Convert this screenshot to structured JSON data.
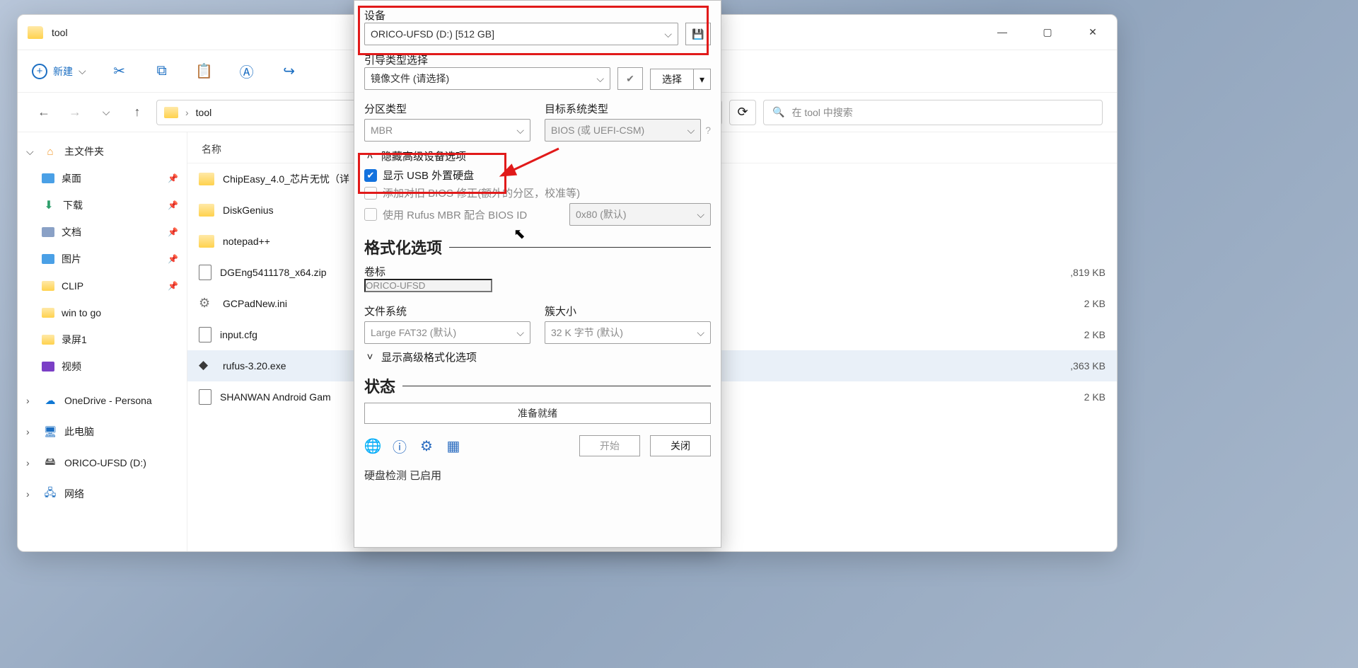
{
  "explorer": {
    "title": "tool",
    "toolbar": {
      "new_label": "新建"
    },
    "address": {
      "label": "tool"
    },
    "search": {
      "placeholder": "在 tool 中搜索"
    },
    "sidebar": {
      "home": "主文件夹",
      "desktop": "桌面",
      "downloads": "下载",
      "documents": "文档",
      "pictures": "图片",
      "clip": "CLIP",
      "wintogo": "win to go",
      "luping": "录屏1",
      "video": "视频",
      "onedrive": "OneDrive - Persona",
      "thispc": "此电脑",
      "orico": "ORICO-UFSD (D:)",
      "network": "网络"
    },
    "columns": {
      "name": "名称"
    },
    "files": [
      {
        "name": "ChipEasy_4.0_芯片无忧（详",
        "type": "folder",
        "size": ""
      },
      {
        "name": "DiskGenius",
        "type": "folder",
        "size": ""
      },
      {
        "name": "notepad++",
        "type": "folder",
        "size": ""
      },
      {
        "name": "DGEng5411178_x64.zip",
        "type": "file",
        "size": ",819 KB"
      },
      {
        "name": "GCPadNew.ini",
        "type": "cfg",
        "size": "2 KB"
      },
      {
        "name": "input.cfg",
        "type": "file",
        "size": "2 KB"
      },
      {
        "name": "rufus-3.20.exe",
        "type": "exe",
        "size": ",363 KB",
        "selected": true
      },
      {
        "name": "SHANWAN Android Gam",
        "type": "file",
        "size": "2 KB"
      }
    ]
  },
  "rufus": {
    "device_label": "设备",
    "device_value": "ORICO-UFSD (D:) [512 GB]",
    "boot_label": "引导类型选择",
    "boot_value": "镜像文件 (请选择)",
    "select_label": "选择",
    "partition_label": "分区类型",
    "partition_value": "MBR",
    "target_label": "目标系统类型",
    "target_value": "BIOS (或 UEFI-CSM)",
    "hide_adv_device": "隐藏高级设备选项",
    "show_usb_hdd": "显示 USB 外置硬盘",
    "bios_fix": "添加对旧 BIOS 修正(额外的分区，校准等)",
    "rufus_mbr": "使用 Rufus MBR 配合 BIOS ID",
    "rufus_mbr_val": "0x80 (默认)",
    "format_head": "格式化选项",
    "vol_label": "卷标",
    "vol_value": "ORICO-UFSD",
    "fs_label": "文件系统",
    "fs_value": "Large FAT32 (默认)",
    "cluster_label": "簇大小",
    "cluster_value": "32 K 字节 (默认)",
    "show_adv_fmt": "显示高级格式化选项",
    "status_head": "状态",
    "progress_text": "准备就绪",
    "start_btn": "开始",
    "close_btn": "关闭",
    "statusline": "硬盘检测 已启用"
  }
}
